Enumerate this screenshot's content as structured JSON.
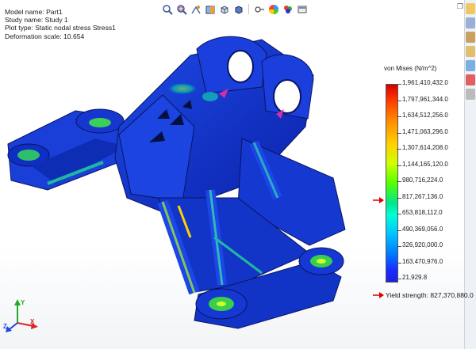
{
  "model_info": {
    "model_name": "Model name: Part1",
    "study_name": "Study name: Study 1",
    "plot_type": "Plot type: Static nodal stress Stress1",
    "deformation_scale": "Deformation scale: 10.654"
  },
  "toolbar": {
    "buttons": [
      "zoom-to-fit-icon",
      "zoom-to-area-icon",
      "previous-view-icon",
      "section-view-icon",
      "view-orientation-icon",
      "display-style-icon",
      "hide-show-items-icon",
      "edit-appearance-icon",
      "apply-scene-icon",
      "view-settings-icon"
    ]
  },
  "legend": {
    "title": "von Mises (N/m^2)",
    "labels": [
      "1,961,410,432.0",
      "1,797,961,344.0",
      "1,634,512,256.0",
      "1,471,063,296.0",
      "1,307,614,208.0",
      "1,144,165,120.0",
      "980,716,224.0",
      "817,267,136.0",
      "653,818,112.0",
      "490,369,056.0",
      "326,920,000.0",
      "163,470,976.0",
      "21,929.8"
    ],
    "yield_strength": "Yield strength: 827,370,880.0",
    "colors": {
      "max": "#d40000",
      "min": "#1e1ee0",
      "marker": "#e00000"
    }
  },
  "triad": {
    "x": "X",
    "y": "Y",
    "z": "Z"
  }
}
